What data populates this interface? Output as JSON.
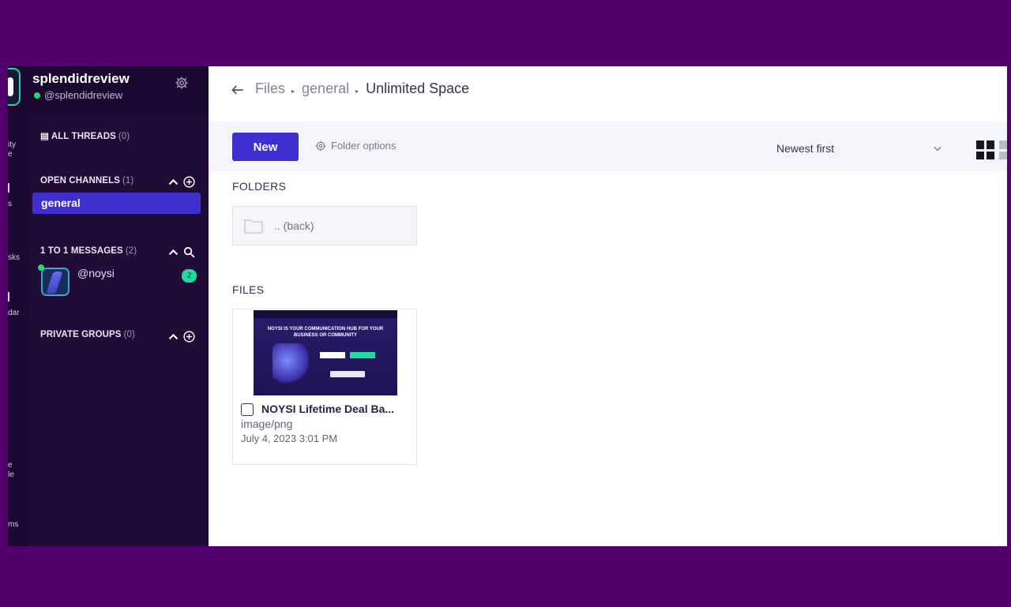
{
  "rail": {
    "items": [
      "ity",
      "e",
      "s",
      "sks",
      "dar",
      "e",
      "le",
      "ms"
    ]
  },
  "sidebar": {
    "workspace_name": "splendidreview",
    "user_handle": "@splendidreview",
    "all_threads": {
      "label": "ALL THREADS",
      "count": "(0)"
    },
    "open_channels": {
      "label": "OPEN CHANNELS",
      "count": "(1)"
    },
    "channels": [
      {
        "label": "general"
      }
    ],
    "direct_messages": {
      "label": "1 TO 1 MESSAGES",
      "count": "(2)"
    },
    "dms": [
      {
        "name": "@noysi",
        "unread": "2"
      }
    ],
    "private_groups": {
      "label": "PRIVATE GROUPS",
      "count": "(0)"
    }
  },
  "header": {
    "breadcrumbs": [
      "Files",
      "general",
      "Unlimited Space"
    ]
  },
  "toolbar": {
    "new_label": "New",
    "folder_options_label": "Folder options",
    "sort_label": "Newest first"
  },
  "folders_section": {
    "title": "FOLDERS",
    "items": [
      {
        "label": ".. (back)"
      }
    ]
  },
  "files_section": {
    "title": "FILES",
    "items": [
      {
        "name": "NOYSI Lifetime Deal Ba...",
        "type": "image/png",
        "date": "July 4, 2023 3:01 PM",
        "thumbnail_headline": "NOYSI IS YOUR COMMUNICATION HUB FOR YOUR BUSINESS OR COMMUNITY"
      }
    ]
  },
  "colors": {
    "background": "#52006e",
    "sidebar": "#210c37",
    "accent": "#3d30cf",
    "online": "#26d96b",
    "badge": "#25d7a0"
  }
}
